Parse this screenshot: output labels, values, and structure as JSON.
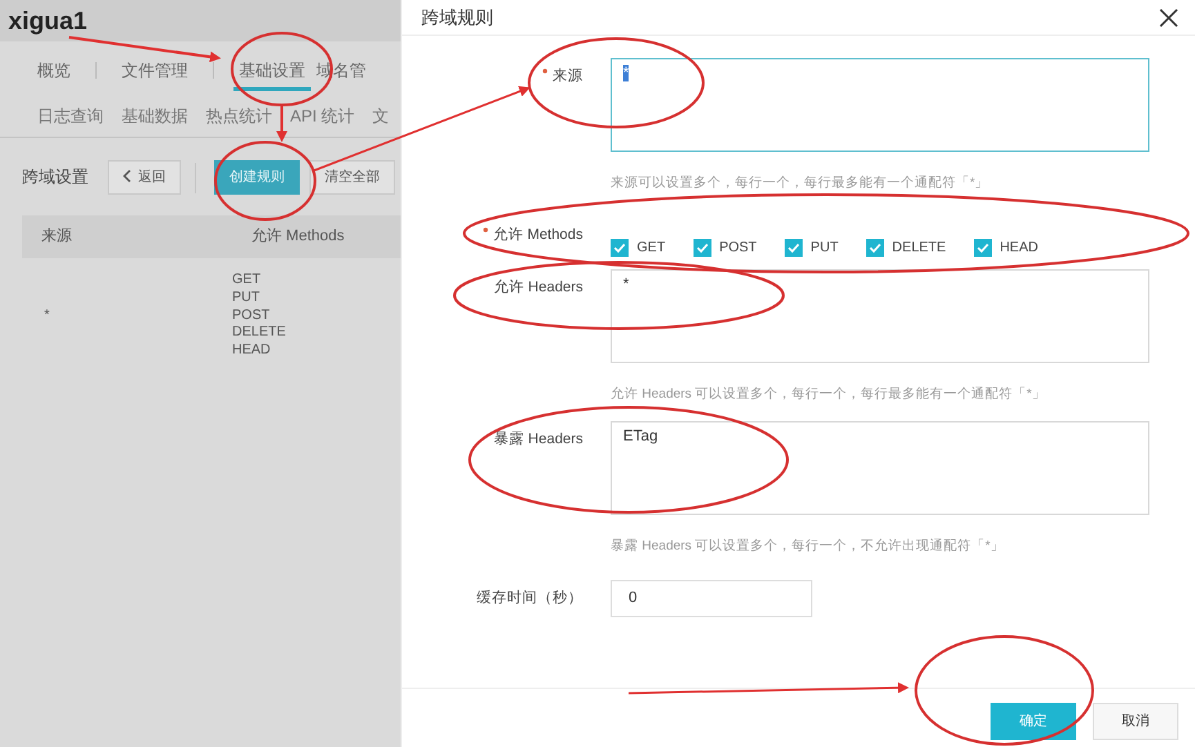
{
  "console": {
    "bucket_title": "xigua1",
    "tabs": [
      {
        "label": "概览",
        "selected": false
      },
      {
        "label": "文件管理",
        "selected": false
      },
      {
        "label": "基础设置",
        "selected": true
      },
      {
        "label": "域名管",
        "selected": false
      }
    ],
    "subtabs": [
      "日志查询",
      "基础数据",
      "热点统计",
      "API 统计",
      "文"
    ],
    "section_title": "跨域设置",
    "toolbar_buttons": [
      {
        "label": "返回",
        "kind": "back"
      },
      {
        "label": "创建规则",
        "kind": "primary"
      },
      {
        "label": "清空全部",
        "kind": "default"
      }
    ],
    "table": {
      "columns": [
        "来源",
        "允许 Methods"
      ],
      "rows": [
        {
          "source": "*",
          "methods": [
            "GET",
            "PUT",
            "POST",
            "DELETE",
            "HEAD"
          ]
        }
      ]
    }
  },
  "dialog": {
    "title": "跨域规则",
    "fields": [
      {
        "kind": "textarea",
        "label": "来源",
        "required": true,
        "value": "*",
        "value_selected": true,
        "focused": true,
        "hint": "来源可以设置多个，每行一个，每行最多能有一个通配符「*」"
      },
      {
        "kind": "checkboxes",
        "label": "允许 Methods",
        "required": true,
        "options": [
          {
            "label": "GET",
            "checked": true
          },
          {
            "label": "POST",
            "checked": true
          },
          {
            "label": "PUT",
            "checked": true
          },
          {
            "label": "DELETE",
            "checked": true
          },
          {
            "label": "HEAD",
            "checked": true
          }
        ]
      },
      {
        "kind": "textarea",
        "label": "允许 Headers",
        "required": false,
        "value": "*",
        "value_selected": false,
        "focused": false,
        "hint": "允许 Headers 可以设置多个，每行一个，每行最多能有一个通配符「*」"
      },
      {
        "kind": "textarea",
        "label": "暴露 Headers",
        "required": false,
        "value": "ETag",
        "value_selected": false,
        "focused": false,
        "hint": "暴露 Headers 可以设置多个，每行一个，不允许出现通配符「*」"
      },
      {
        "kind": "input",
        "label": "缓存时间（秒）",
        "required": false,
        "value": "0"
      }
    ],
    "buttons": [
      {
        "label": "确定",
        "kind": "primary"
      },
      {
        "label": "取消",
        "kind": "default"
      }
    ]
  }
}
